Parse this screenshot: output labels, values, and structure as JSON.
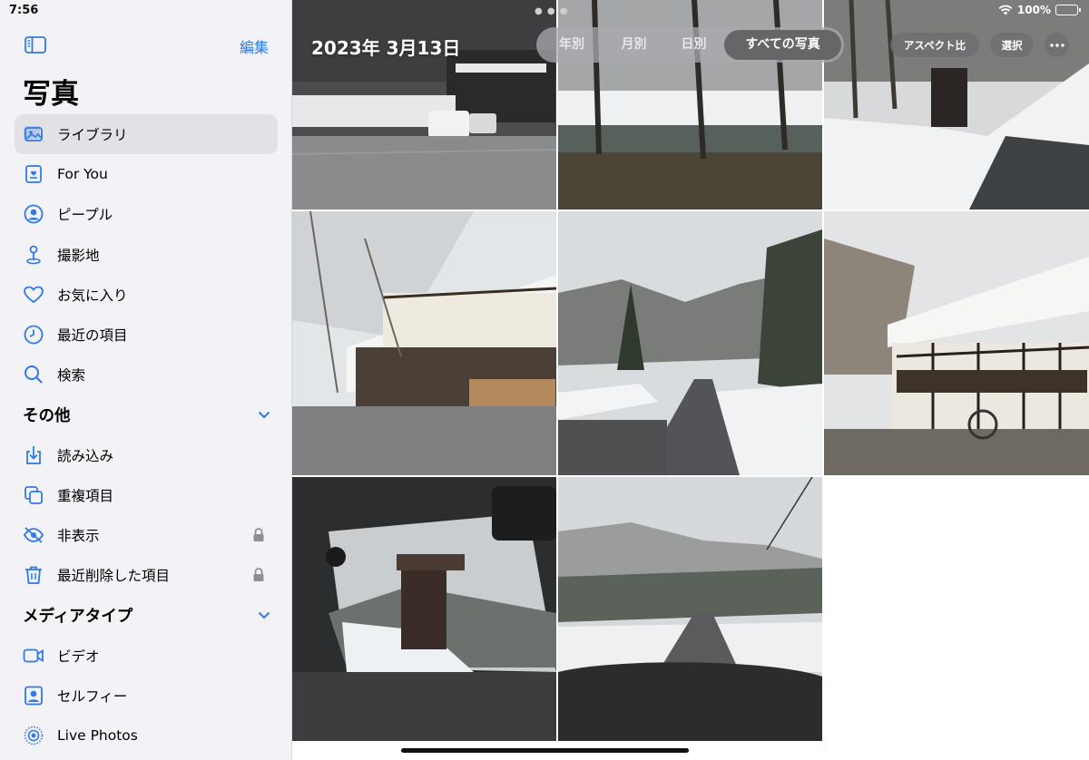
{
  "status_bar": {
    "time": "7:56",
    "battery": "100%",
    "battery_level": 1.0
  },
  "sidebar": {
    "edit_label": "編集",
    "title": "写真",
    "items": [
      {
        "label": "ライブラリ",
        "icon": "photo-library-icon",
        "active": true
      },
      {
        "label": "For You",
        "icon": "for-you-icon"
      },
      {
        "label": "ピープル",
        "icon": "person-circle-icon"
      },
      {
        "label": "撮影地",
        "icon": "map-pin-icon"
      },
      {
        "label": "お気に入り",
        "icon": "heart-icon"
      },
      {
        "label": "最近の項目",
        "icon": "clock-icon"
      },
      {
        "label": "検索",
        "icon": "search-icon"
      }
    ],
    "sections": [
      {
        "title": "その他",
        "items": [
          {
            "label": "読み込み",
            "icon": "import-icon"
          },
          {
            "label": "重複項目",
            "icon": "duplicates-icon"
          },
          {
            "label": "非表示",
            "icon": "eye-slash-icon",
            "locked": true
          },
          {
            "label": "最近削除した項目",
            "icon": "trash-icon",
            "locked": true
          }
        ]
      },
      {
        "title": "メディアタイプ",
        "items": [
          {
            "label": "ビデオ",
            "icon": "video-icon"
          },
          {
            "label": "セルフィー",
            "icon": "selfie-icon"
          },
          {
            "label": "Live Photos",
            "icon": "live-photos-icon"
          }
        ]
      }
    ]
  },
  "main": {
    "date_title": "2023年 3月13日",
    "view_tabs": [
      {
        "label": "年別"
      },
      {
        "label": "月別"
      },
      {
        "label": "日別"
      },
      {
        "label": "すべての写真",
        "active": true
      }
    ],
    "aspect_label": "アスペクト比",
    "select_label": "選択"
  },
  "colors": {
    "accent": "#2f7ae5",
    "sidebar_bg": "#f2f2f7",
    "battery_green": "#4cd964"
  }
}
